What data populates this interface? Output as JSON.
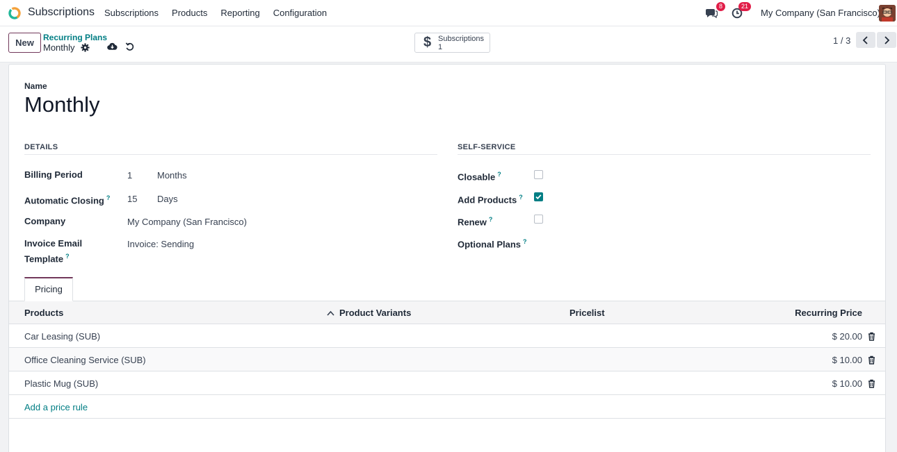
{
  "navbar": {
    "app_name": "Subscriptions",
    "menu": [
      "Subscriptions",
      "Products",
      "Reporting",
      "Configuration"
    ],
    "messages_count": "8",
    "activities_count": "21",
    "company": "My Company (San Francisco)"
  },
  "control": {
    "new_label": "New",
    "breadcrumb_parent": "Recurring Plans",
    "breadcrumb_current": "Monthly",
    "smart_button": {
      "label": "Subscriptions",
      "count": "1"
    },
    "pager": "1 / 3"
  },
  "form": {
    "name_label": "Name",
    "name_value": "Monthly",
    "details": {
      "heading": "DETAILS",
      "billing_period_label": "Billing Period",
      "billing_period_value": "1",
      "billing_period_unit": "Months",
      "auto_close_label": "Automatic Closing",
      "auto_close_value": "15",
      "auto_close_unit": "Days",
      "company_label": "Company",
      "company_value": "My Company (San Francisco)",
      "invoice_label_1": "Invoice Email",
      "invoice_label_2": "Template",
      "invoice_value": "Invoice: Sending"
    },
    "self_service": {
      "heading": "SELF-SERVICE",
      "closable_label": "Closable",
      "closable_checked": false,
      "add_products_label": "Add Products",
      "add_products_checked": true,
      "renew_label": "Renew",
      "renew_checked": false,
      "optional_plans_label": "Optional Plans"
    },
    "help_marker": "?"
  },
  "tabs": {
    "pricing": "Pricing"
  },
  "table": {
    "columns": [
      "Products",
      "Product Variants",
      "Pricelist",
      "Recurring Price"
    ],
    "rows": [
      {
        "product": "Car Leasing (SUB)",
        "price": "$ 20.00"
      },
      {
        "product": "Office Cleaning Service (SUB)",
        "price": "$ 10.00"
      },
      {
        "product": "Plastic Mug (SUB)",
        "price": "$ 10.00"
      }
    ],
    "add_rule": "Add a price rule"
  },
  "colors": {
    "accent": "#017e84",
    "brand": "#71385a",
    "badge": "#e11d48"
  }
}
